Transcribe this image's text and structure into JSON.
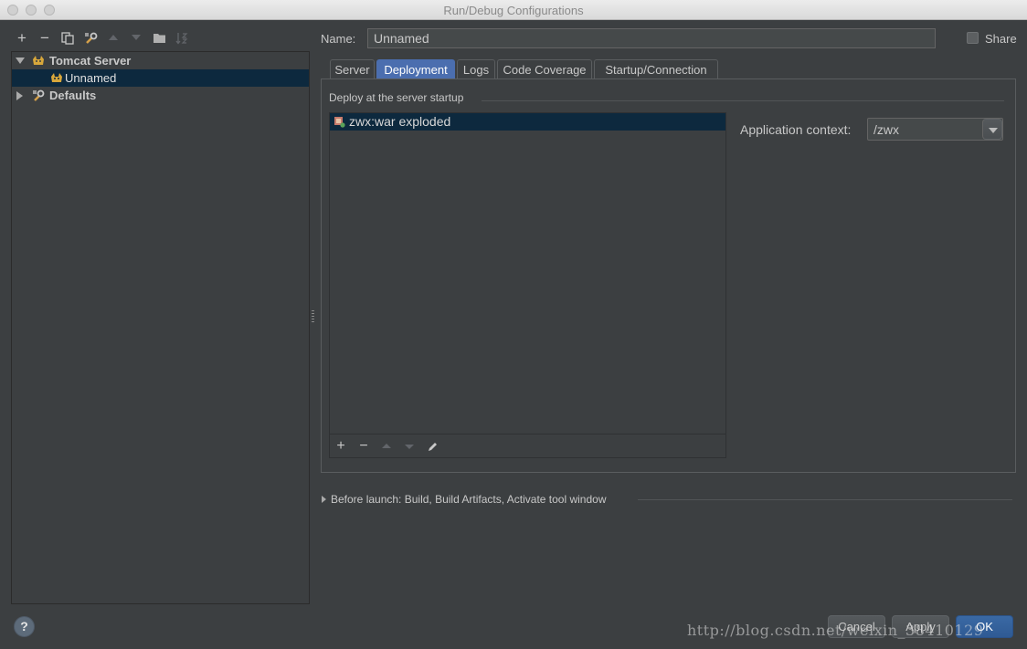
{
  "window": {
    "title": "Run/Debug Configurations"
  },
  "toolbar": {
    "add": "+",
    "remove": "−",
    "icons": [
      "add-icon",
      "remove-icon",
      "copy-icon",
      "wrench-icon",
      "move-up-icon",
      "move-down-icon",
      "folder-icon",
      "sort-icon"
    ]
  },
  "tree": {
    "items": [
      {
        "label": "Tomcat Server",
        "icon": "tomcat-icon",
        "expanded": true
      },
      {
        "label": "Unnamed",
        "icon": "tomcat-icon",
        "selected": true
      },
      {
        "label": "Defaults",
        "icon": "wrench-icon",
        "expanded": false
      }
    ]
  },
  "name": {
    "label": "Name:",
    "value": "Unnamed"
  },
  "share": {
    "label": "Share",
    "checked": false
  },
  "tabs": [
    {
      "label": "Server"
    },
    {
      "label": "Deployment",
      "active": true
    },
    {
      "label": "Logs"
    },
    {
      "label": "Code Coverage"
    },
    {
      "label": "Startup/Connection"
    }
  ],
  "deployment": {
    "section_title": "Deploy at the server startup",
    "artifacts": [
      {
        "label": "zwx:war exploded",
        "icon": "artifact-icon",
        "selected": true
      }
    ],
    "list_toolbar": {
      "add": "+",
      "remove": "−"
    },
    "app_context": {
      "label": "Application context:",
      "value": "/zwx"
    }
  },
  "before_launch": {
    "label": "Before launch: Build, Build Artifacts, Activate tool window"
  },
  "buttons": {
    "help": "?",
    "cancel": "Cancel",
    "apply": "Apply",
    "ok": "OK"
  },
  "watermark": "http://blog.csdn.net/weixin_38410129",
  "colors": {
    "background": "#3c3f41",
    "selection": "#0d293e",
    "active_tab": "#4b6eaf",
    "primary_button": "#2f5a94"
  }
}
